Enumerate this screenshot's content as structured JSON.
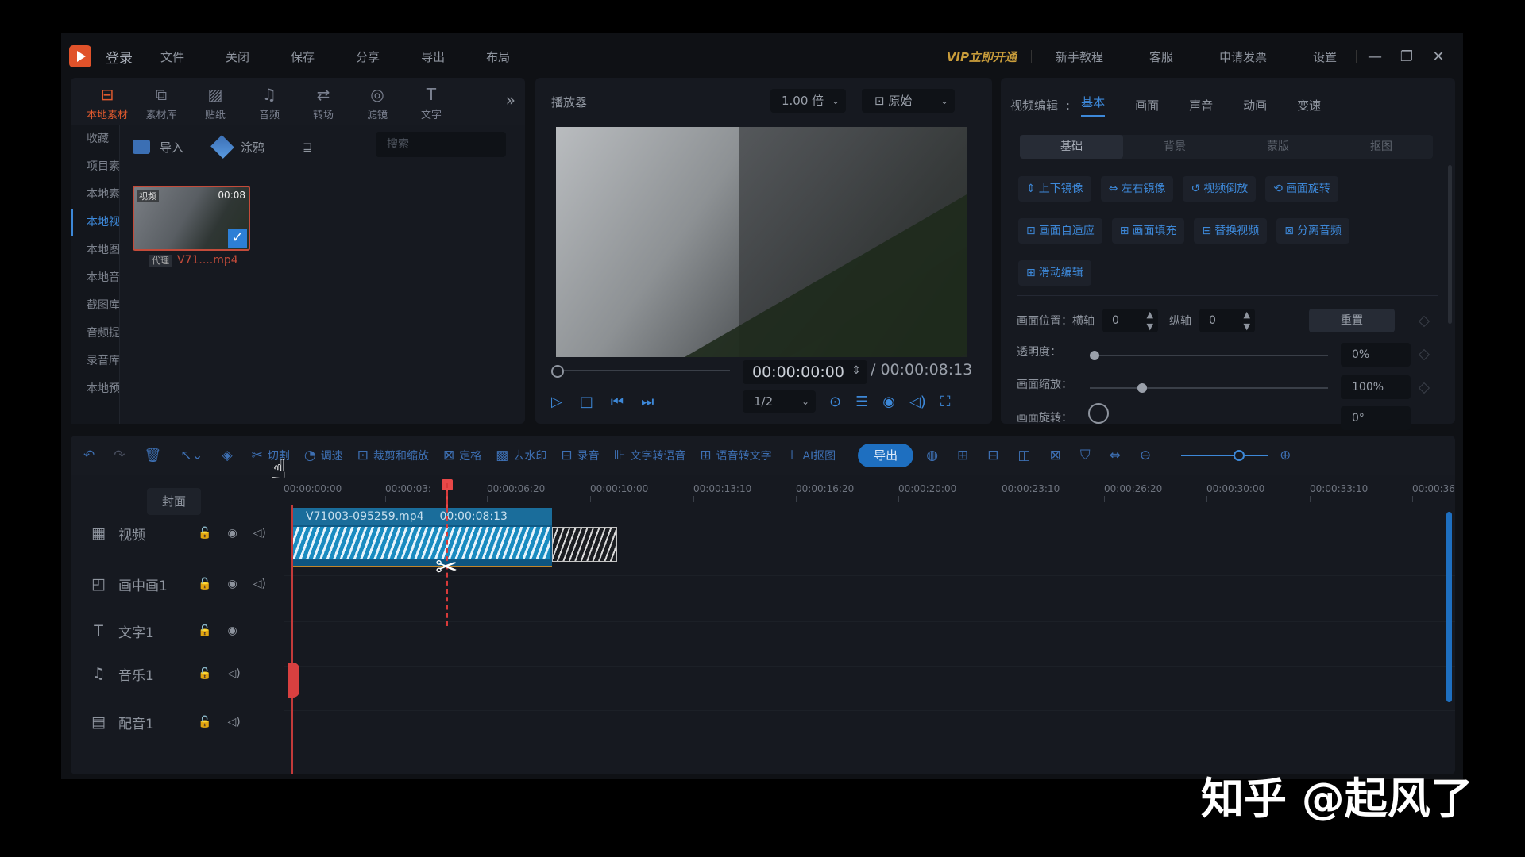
{
  "topbar": {
    "login": "登录",
    "menu": [
      "文件",
      "关闭",
      "保存",
      "分享",
      "导出",
      "布局"
    ],
    "vip": "VIP立即开通",
    "right": [
      "新手教程",
      "客服",
      "申请发票",
      "设置"
    ]
  },
  "media": {
    "tabs": [
      {
        "label": "本地素材",
        "icon": "folder-icon",
        "glyph": "⊟"
      },
      {
        "label": "素材库",
        "icon": "library-icon",
        "glyph": "⧉"
      },
      {
        "label": "贴纸",
        "icon": "sticker-icon",
        "glyph": "▨"
      },
      {
        "label": "音频",
        "icon": "music-icon",
        "glyph": "♫"
      },
      {
        "label": "转场",
        "icon": "transition-icon",
        "glyph": "⇄"
      },
      {
        "label": "滤镜",
        "icon": "filter-icon",
        "glyph": "◎"
      },
      {
        "label": "文字",
        "icon": "text-icon",
        "glyph": "T"
      }
    ],
    "sidebar": [
      "收藏",
      "项目素",
      "本地素",
      "本地视",
      "本地图",
      "本地音",
      "截图库",
      "音频提",
      "录音库",
      "本地预"
    ],
    "import_label": "导入",
    "paint_label": "涂鸦",
    "sort_icon": "⊒",
    "search_placeholder": "搜索",
    "thumb": {
      "tag": "视频",
      "duration": "00:08",
      "proxy": "代理",
      "name": "V71....mp4"
    }
  },
  "player": {
    "title": "播放器",
    "speed": "1.00 倍",
    "ratio": "原始",
    "timecode": "00:00:00:00",
    "total": "/  00:00:08:13",
    "zoom": "1/2"
  },
  "props": {
    "title": "视频编辑",
    "tabs": [
      "基本",
      "画面",
      "声音",
      "动画",
      "变速"
    ],
    "subtabs": [
      "基础",
      "背景",
      "蒙版",
      "抠图"
    ],
    "row1": [
      "上下镜像",
      "左右镜像",
      "视频倒放",
      "画面旋转"
    ],
    "row2": [
      "画面自适应",
      "画面填充",
      "替换视频",
      "分离音频"
    ],
    "row3": [
      "滑动编辑"
    ],
    "position_label": "画面位置：",
    "x_label": "横轴",
    "x_value": "0",
    "y_label": "纵轴",
    "y_value": "0",
    "reset": "重置",
    "opacity_label": "透明度：",
    "opacity_value": "0%",
    "opacity_level": 0,
    "scale_label": "画面缩放：",
    "scale_value": "100%",
    "scale_level": 0.2,
    "rotate_label": "画面旋转：",
    "rotate_value": "0°"
  },
  "timeline": {
    "tools": [
      "切割",
      "调速",
      "裁剪和缩放",
      "定格",
      "去水印",
      "录音",
      "文字转语音",
      "语音转文字",
      "AI抠图"
    ],
    "export": "导出",
    "cover": "封面",
    "ruler": [
      "00:00:00:00",
      "00:00:03:",
      "00:00:06:20",
      "00:00:10:00",
      "00:00:13:10",
      "00:00:16:20",
      "00:00:20:00",
      "00:00:23:10",
      "00:00:26:20",
      "00:00:30:00",
      "00:00:33:10",
      "00:00:36"
    ],
    "tracks": [
      {
        "name": "视频",
        "icon": "film-icon",
        "glyph": "▦"
      },
      {
        "name": "画中画1",
        "icon": "pip-icon",
        "glyph": "◰"
      },
      {
        "name": "文字1",
        "icon": "text-icon",
        "glyph": "T"
      },
      {
        "name": "音乐1",
        "icon": "music-icon",
        "glyph": "♫"
      },
      {
        "name": "配音1",
        "icon": "voice-icon",
        "glyph": "▤"
      }
    ],
    "clip_name": "V71003-095259.mp4",
    "clip_duration": "00:00:08:13"
  },
  "watermark": "知乎 @起风了"
}
